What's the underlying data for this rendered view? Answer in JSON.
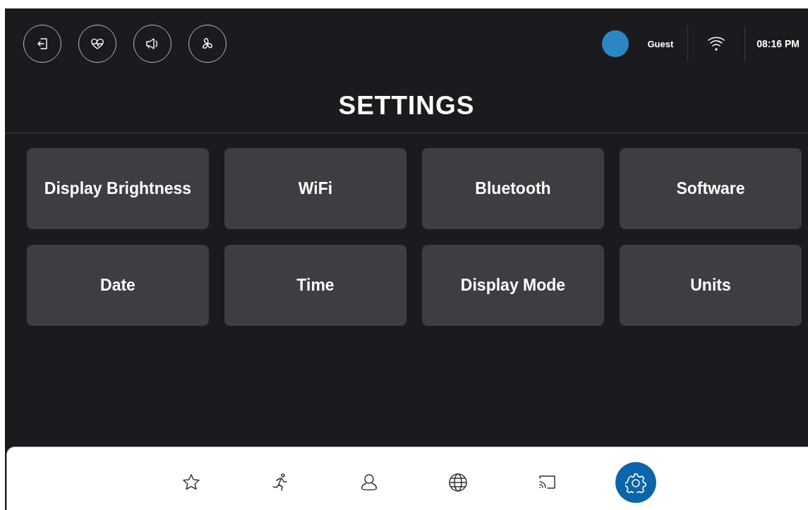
{
  "header": {
    "user": "Guest",
    "time": "08:16 PM"
  },
  "title": "SETTINGS",
  "tiles": [
    "Display Brightness",
    "WiFi",
    "Bluetooth",
    "Software",
    "Date",
    "Time",
    "Display Mode",
    "Units"
  ],
  "nav": [
    {
      "selected": false
    },
    {
      "selected": false
    },
    {
      "selected": false
    },
    {
      "selected": false
    },
    {
      "selected": false
    },
    {
      "selected": true
    }
  ]
}
